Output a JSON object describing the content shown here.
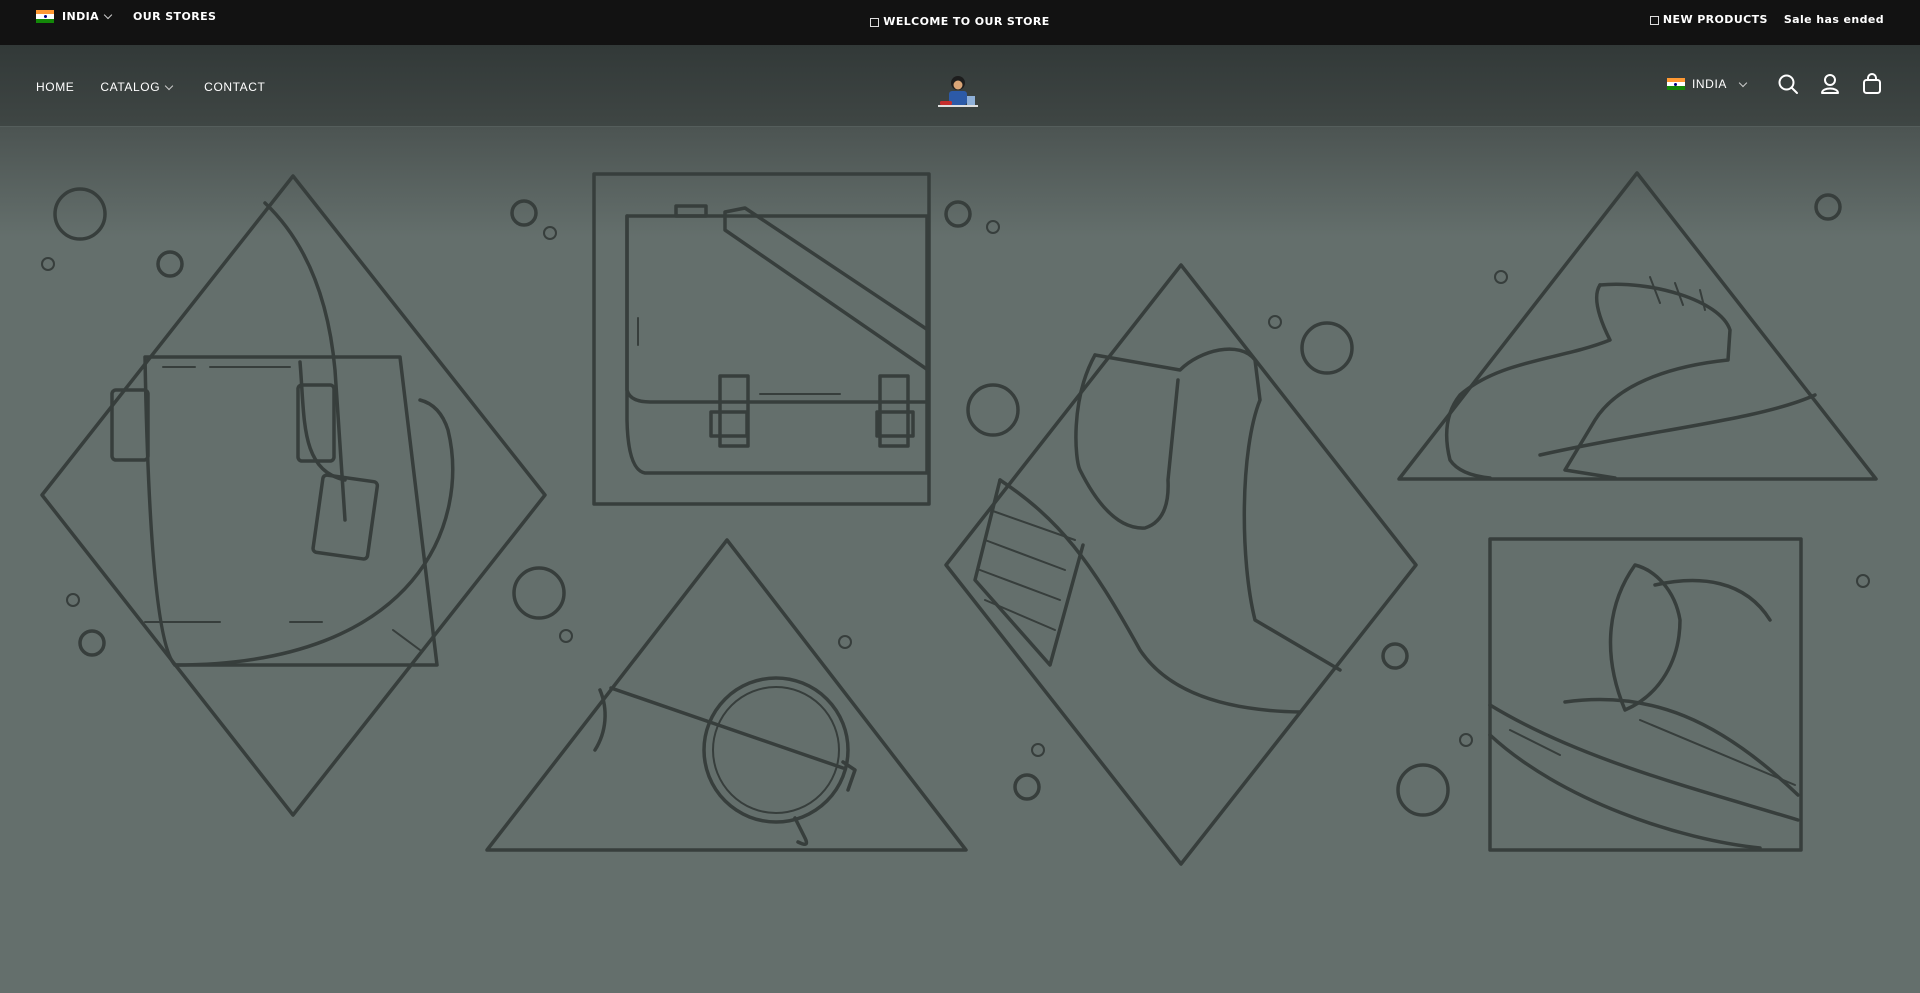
{
  "announcement": {
    "country": "INDIA",
    "stores_link": "OUR STORES",
    "welcome": "WELCOME TO OUR STORE",
    "new_products": "NEW PRODUCTS",
    "sale_status": "Sale has ended"
  },
  "header": {
    "nav": [
      {
        "label": "HOME"
      },
      {
        "label": "CATALOG"
      },
      {
        "label": "CONTACT"
      }
    ],
    "country": "INDIA",
    "icons": [
      "search-icon",
      "account-icon",
      "cart-icon"
    ]
  },
  "colors": {
    "topbar_bg": "#121212",
    "header_bg": "#3f4644",
    "hero_bg": "#646f6c",
    "line_art": "#373e3c"
  }
}
